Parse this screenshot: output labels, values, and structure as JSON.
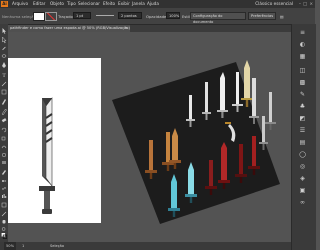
{
  "app": {
    "logo": "Ai"
  },
  "menu": {
    "items": [
      "Arquivo",
      "Editar",
      "Objeto",
      "Tipo",
      "Selecionar",
      "Efeito",
      "Exibir",
      "Janela",
      "Ajuda"
    ],
    "workspace": "Clássico essencial"
  },
  "control_bar": {
    "selection_label": "Nenhuma seleção",
    "stroke_label": "Traçado",
    "stroke_value": "1 pt",
    "brush_value": "2 pontos",
    "opacity_label": "Opacidade:",
    "opacity_value": "100%",
    "style_label": "Estilo:",
    "doc_setup_label": "Configuração do documento",
    "preferences_label": "Preferências"
  },
  "document_tab": {
    "title": "pathfinder e como fazer uma espada.ai @ 50% (RGB/Visualização)",
    "close": "×"
  },
  "status": {
    "zoom": "50%",
    "page": "1",
    "tool": "Seleção"
  },
  "colors": {
    "accent": "#e7791a",
    "ui_dark": "#323232",
    "panel": "#3a3a3a",
    "canvas": "#535353",
    "artboard": "#ffffff",
    "dark_artboard": "#1c1c1c"
  },
  "icons": {
    "tools": [
      "selection-icon",
      "direct-selection-icon",
      "magic-wand-icon",
      "lasso-icon",
      "pen-icon",
      "type-icon",
      "line-icon",
      "rectangle-icon",
      "paintbrush-icon",
      "pencil-icon",
      "eraser-icon",
      "rotate-icon",
      "scale-icon",
      "width-icon",
      "shape-builder-icon",
      "gradient-icon",
      "eyedropper-icon",
      "blend-icon",
      "symbol-sprayer-icon",
      "graph-icon",
      "artboard-icon",
      "slice-icon",
      "hand-icon",
      "zoom-icon",
      "fill-stroke-icon"
    ],
    "panels": [
      "libraries-icon",
      "properties-icon",
      "color-icon",
      "color-guide-icon",
      "swatches-icon",
      "brushes-icon",
      "symbols-icon",
      "graphic-styles-icon",
      "stroke-icon",
      "gradient-panel-icon",
      "transparency-icon",
      "appearance-icon",
      "layers-icon",
      "artboards-icon",
      "links-icon"
    ]
  }
}
